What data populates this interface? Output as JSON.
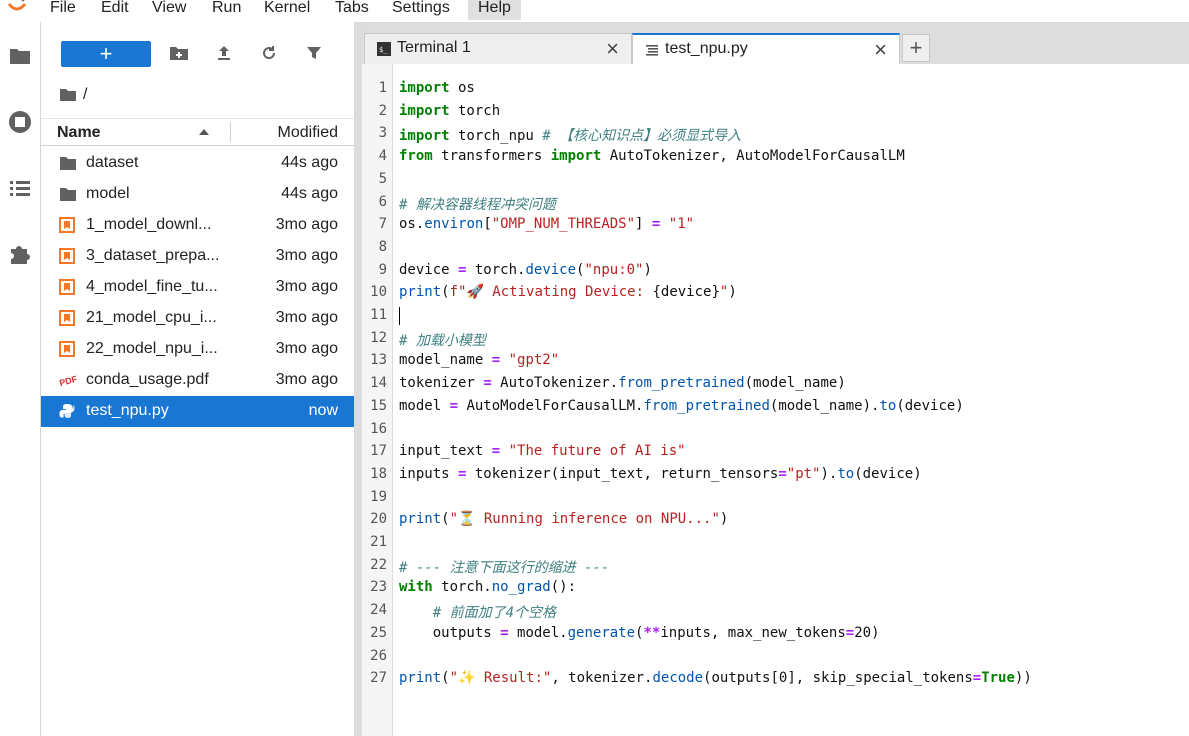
{
  "menu": {
    "items": [
      "File",
      "Edit",
      "View",
      "Run",
      "Kernel",
      "Tabs",
      "Settings",
      "Help"
    ],
    "active": "Help"
  },
  "left_strip": {
    "icons": [
      "folder-icon",
      "stop-circle-icon",
      "list-icon",
      "puzzle-icon"
    ]
  },
  "file_browser": {
    "new_button_label": "+",
    "toolbar_icons": [
      "new-folder-icon",
      "upload-icon",
      "refresh-icon",
      "filter-icon"
    ],
    "breadcrumb": "/",
    "columns": {
      "name": "Name",
      "modified": "Modified"
    },
    "files": [
      {
        "name": "dataset",
        "modified": "44s ago",
        "type": "folder"
      },
      {
        "name": "model",
        "modified": "44s ago",
        "type": "folder"
      },
      {
        "name": "1_model_downl...",
        "modified": "3mo ago",
        "type": "notebook"
      },
      {
        "name": "3_dataset_prepa...",
        "modified": "3mo ago",
        "type": "notebook"
      },
      {
        "name": "4_model_fine_tu...",
        "modified": "3mo ago",
        "type": "notebook"
      },
      {
        "name": "21_model_cpu_i...",
        "modified": "3mo ago",
        "type": "notebook"
      },
      {
        "name": "22_model_npu_i...",
        "modified": "3mo ago",
        "type": "notebook"
      },
      {
        "name": "conda_usage.pdf",
        "modified": "3mo ago",
        "type": "pdf"
      },
      {
        "name": "test_npu.py",
        "modified": "now",
        "type": "python",
        "selected": true
      }
    ]
  },
  "tabs": [
    {
      "label": "Terminal 1",
      "icon": "terminal-icon",
      "active": false
    },
    {
      "label": "test_npu.py",
      "icon": "text-file-icon",
      "active": true
    }
  ],
  "add_tab_label": "+",
  "editor": {
    "line_numbers": [
      "1",
      "2",
      "3",
      "4",
      "5",
      "6",
      "7",
      "8",
      "9",
      "10",
      "11",
      "12",
      "13",
      "14",
      "15",
      "16",
      "17",
      "18",
      "19",
      "20",
      "21",
      "22",
      "23",
      "24",
      "25",
      "26",
      "27"
    ],
    "cursor_line": 11,
    "lines": [
      [
        {
          "t": "kw",
          "v": "import"
        },
        {
          "t": "",
          "v": " os"
        }
      ],
      [
        {
          "t": "kw",
          "v": "import"
        },
        {
          "t": "",
          "v": " torch"
        }
      ],
      [
        {
          "t": "kw",
          "v": "import"
        },
        {
          "t": "",
          "v": " torch_npu "
        },
        {
          "t": "cm",
          "v": "# 【核心知识点】必须显式导入"
        }
      ],
      [
        {
          "t": "kw",
          "v": "from"
        },
        {
          "t": "",
          "v": " transformers "
        },
        {
          "t": "kw",
          "v": "import"
        },
        {
          "t": "",
          "v": " AutoTokenizer, AutoModelForCausalLM"
        }
      ],
      [],
      [
        {
          "t": "cm",
          "v": "# 解决容器线程冲突问题"
        }
      ],
      [
        {
          "t": "",
          "v": "os."
        },
        {
          "t": "fn",
          "v": "environ"
        },
        {
          "t": "",
          "v": "["
        },
        {
          "t": "st",
          "v": "\"OMP_NUM_THREADS\""
        },
        {
          "t": "",
          "v": "] "
        },
        {
          "t": "op",
          "v": "="
        },
        {
          "t": "",
          "v": " "
        },
        {
          "t": "st",
          "v": "\"1\""
        }
      ],
      [],
      [
        {
          "t": "",
          "v": "device "
        },
        {
          "t": "op",
          "v": "="
        },
        {
          "t": "",
          "v": " torch."
        },
        {
          "t": "fn",
          "v": "device"
        },
        {
          "t": "",
          "v": "("
        },
        {
          "t": "st",
          "v": "\"npu:0\""
        },
        {
          "t": "",
          "v": ")"
        }
      ],
      [
        {
          "t": "fn",
          "v": "print"
        },
        {
          "t": "",
          "v": "("
        },
        {
          "t": "st",
          "v": "f\"🚀 Activating Device: "
        },
        {
          "t": "",
          "v": "{device}"
        },
        {
          "t": "st",
          "v": "\""
        },
        {
          "t": "",
          "v": ")"
        }
      ],
      [],
      [
        {
          "t": "cm",
          "v": "# 加载小模型"
        }
      ],
      [
        {
          "t": "",
          "v": "model_name "
        },
        {
          "t": "op",
          "v": "="
        },
        {
          "t": "",
          "v": " "
        },
        {
          "t": "st",
          "v": "\"gpt2\""
        }
      ],
      [
        {
          "t": "",
          "v": "tokenizer "
        },
        {
          "t": "op",
          "v": "="
        },
        {
          "t": "",
          "v": " AutoTokenizer."
        },
        {
          "t": "fn",
          "v": "from_pretrained"
        },
        {
          "t": "",
          "v": "(model_name)"
        }
      ],
      [
        {
          "t": "",
          "v": "model "
        },
        {
          "t": "op",
          "v": "="
        },
        {
          "t": "",
          "v": " AutoModelForCausalLM."
        },
        {
          "t": "fn",
          "v": "from_pretrained"
        },
        {
          "t": "",
          "v": "(model_name)."
        },
        {
          "t": "fn",
          "v": "to"
        },
        {
          "t": "",
          "v": "(device)"
        }
      ],
      [],
      [
        {
          "t": "",
          "v": "input_text "
        },
        {
          "t": "op",
          "v": "="
        },
        {
          "t": "",
          "v": " "
        },
        {
          "t": "st",
          "v": "\"The future of AI is\""
        }
      ],
      [
        {
          "t": "",
          "v": "inputs "
        },
        {
          "t": "op",
          "v": "="
        },
        {
          "t": "",
          "v": " tokenizer(input_text, return_tensors"
        },
        {
          "t": "op",
          "v": "="
        },
        {
          "t": "st",
          "v": "\"pt\""
        },
        {
          "t": "",
          "v": ")."
        },
        {
          "t": "fn",
          "v": "to"
        },
        {
          "t": "",
          "v": "(device)"
        }
      ],
      [],
      [
        {
          "t": "fn",
          "v": "print"
        },
        {
          "t": "",
          "v": "("
        },
        {
          "t": "st",
          "v": "\"⏳ Running inference on NPU...\""
        },
        {
          "t": "",
          "v": ")"
        }
      ],
      [],
      [
        {
          "t": "cm",
          "v": "# --- 注意下面这行的缩进 ---"
        }
      ],
      [
        {
          "t": "kw",
          "v": "with"
        },
        {
          "t": "",
          "v": " torch."
        },
        {
          "t": "fn",
          "v": "no_grad"
        },
        {
          "t": "",
          "v": "():"
        }
      ],
      [
        {
          "t": "",
          "v": "    "
        },
        {
          "t": "cm",
          "v": "# 前面加了4个空格"
        }
      ],
      [
        {
          "t": "",
          "v": "    outputs "
        },
        {
          "t": "op",
          "v": "="
        },
        {
          "t": "",
          "v": " model."
        },
        {
          "t": "fn",
          "v": "generate"
        },
        {
          "t": "",
          "v": "("
        },
        {
          "t": "op",
          "v": "**"
        },
        {
          "t": "",
          "v": "inputs, max_new_tokens"
        },
        {
          "t": "op",
          "v": "="
        },
        {
          "t": "",
          "v": "20)"
        }
      ],
      [],
      [
        {
          "t": "fn",
          "v": "print"
        },
        {
          "t": "",
          "v": "("
        },
        {
          "t": "st",
          "v": "\"✨ Result:\""
        },
        {
          "t": "",
          "v": ", tokenizer."
        },
        {
          "t": "fn",
          "v": "decode"
        },
        {
          "t": "",
          "v": "(outputs[0], skip_special_tokens"
        },
        {
          "t": "op",
          "v": "="
        },
        {
          "t": "kw",
          "v": "True"
        },
        {
          "t": "",
          "v": "))"
        }
      ]
    ]
  },
  "colors": {
    "accent": "#1976d2",
    "notebook_icon": "#f37726",
    "pdf_icon": "#d32f2f"
  }
}
